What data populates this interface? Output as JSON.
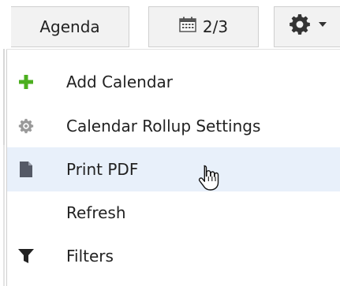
{
  "toolbar": {
    "agenda_label": "Agenda",
    "page_label": "2/3",
    "settings_icon": "gear-icon"
  },
  "menu": {
    "items": [
      {
        "label": "Add Calendar",
        "icon": "plus-icon",
        "icon_color": "#4caf1f"
      },
      {
        "label": "Calendar Rollup Settings",
        "icon": "gear-icon",
        "icon_color": "#9a9a9a"
      },
      {
        "label": "Print PDF",
        "icon": "document-icon",
        "icon_color": "#555a66",
        "hovered": true
      },
      {
        "label": "Refresh",
        "icon": ""
      },
      {
        "label": "Filters",
        "icon": "funnel-icon",
        "icon_color": "#222222"
      }
    ]
  },
  "colors": {
    "hover_bg": "#e8f0fa",
    "button_bg": "#f2f2f2",
    "button_border": "#cfcfcf"
  }
}
